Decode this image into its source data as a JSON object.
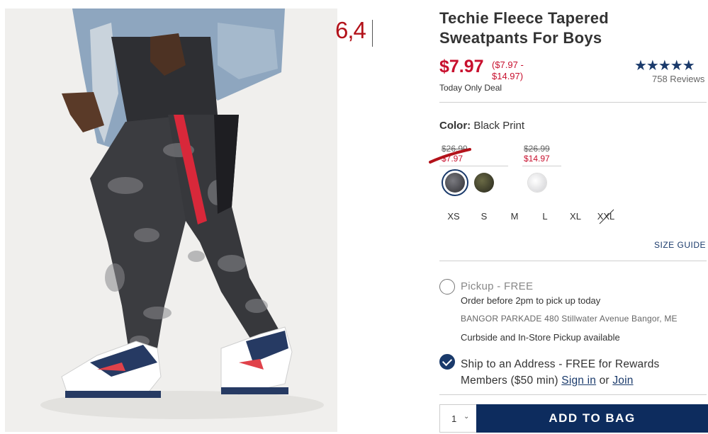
{
  "annotation": {
    "text": "6,4"
  },
  "product": {
    "title": "Techie Fleece Tapered Sweatpants For Boys",
    "price": "$7.97",
    "price_range_line1": "($7.97 -",
    "price_range_line2": "$14.97)",
    "deal_note": "Today Only Deal",
    "rating_stars": "★★★★★",
    "reviews": "758 Reviews"
  },
  "color": {
    "label": "Color:",
    "selected": "Black Print",
    "groups": [
      {
        "original": "$26.99",
        "sale": "$7.97",
        "swatches": [
          {
            "name": "black-print",
            "color": "#4b4b4f",
            "selected": true
          },
          {
            "name": "camo",
            "color": "#4a4a32",
            "selected": false
          }
        ]
      },
      {
        "original": "$26.99",
        "sale": "$14.97",
        "swatches": [
          {
            "name": "white",
            "color": "#e4e4e6",
            "selected": false
          }
        ]
      }
    ]
  },
  "sizes": [
    "XS",
    "S",
    "M",
    "L",
    "XL",
    "XXL"
  ],
  "size_guide": "SIZE GUIDE",
  "fulfillment": {
    "pickup_title": "Pickup - FREE",
    "pickup_sub": "Order before 2pm to pick up today",
    "store": "BANGOR PARKADE 480 Stillwater Avenue  Bangor, ME",
    "curbside": "Curbside and In-Store Pickup available",
    "ship_text": "Ship to an Address - FREE for Rewards Members ($50 min)",
    "sign_in": "Sign in",
    "or": "or",
    "join": "Join"
  },
  "cart": {
    "quantity": "1",
    "add_label": "ADD TO BAG"
  },
  "colors": {
    "accent_red": "#c8102e",
    "navy": "#0d2c5e"
  }
}
